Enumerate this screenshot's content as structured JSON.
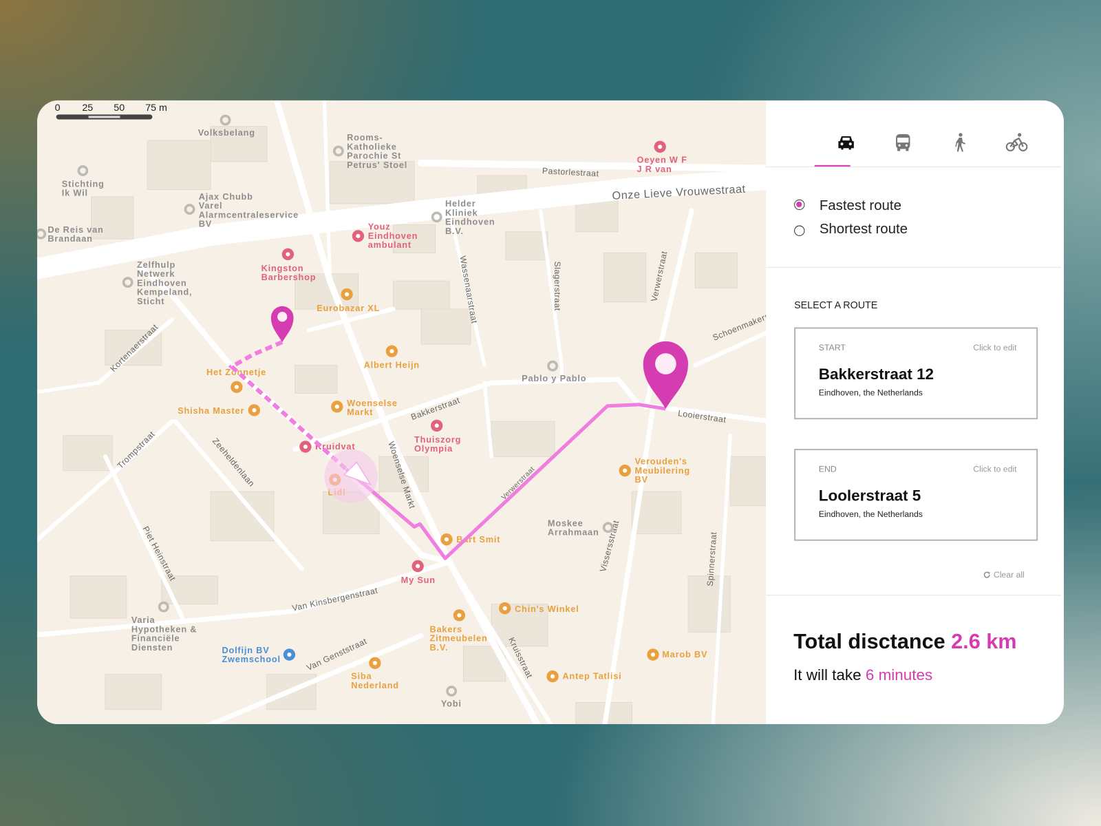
{
  "colors": {
    "accent": "#d63cb1",
    "route": "#f07ee0",
    "poi_gray": "#8e8e8e",
    "poi_pink": "#e0627c",
    "poi_orange": "#e9a03f",
    "poi_blue": "#4a8fd6"
  },
  "map": {
    "scale": {
      "ticks": [
        "0",
        "25",
        "50",
        "75 m"
      ]
    },
    "streets": [
      "Onze Lieve Vrouwestraat",
      "Pastorlestraat",
      "Wassenaarstraat",
      "Slagerstraat",
      "Verwerstraat",
      "Schoenmakerstraat",
      "Kortenaerstraat",
      "Trompstraat",
      "Zeeheldenlaan",
      "Piet Heinstraat",
      "Bakkerstraat",
      "Woenselse Markt",
      "Looierstraat",
      "Vissersstraat",
      "Spinnerstraat",
      "Van Kinsbergenstraat",
      "Van Genststraat",
      "Kruisstraat",
      "Verwerstraat"
    ],
    "pois": [
      {
        "lines": [
          "Volksbelang"
        ],
        "kind": "gray",
        "icon": "place-icon"
      },
      {
        "lines": [
          "Rooms-",
          "Katholieke",
          "Parochie St",
          "Petrus' Stoel"
        ],
        "kind": "gray",
        "icon": "place-icon"
      },
      {
        "lines": [
          "Stichting",
          "Ik Wil"
        ],
        "kind": "gray",
        "icon": "place-icon"
      },
      {
        "lines": [
          "Ajax Chubb",
          "Varel",
          "Alarmcentraleservice",
          "BV"
        ],
        "kind": "gray",
        "icon": "place-icon"
      },
      {
        "lines": [
          "De Reis van",
          "Brandaan"
        ],
        "kind": "gray",
        "icon": "place-icon"
      },
      {
        "lines": [
          "Helder",
          "Kliniek",
          "Eindhoven",
          "B.V."
        ],
        "kind": "gray",
        "icon": "place-icon"
      },
      {
        "lines": [
          "Zelfhulp",
          "Netwerk",
          "Eindhoven",
          "Kempeland,",
          "Sticht"
        ],
        "kind": "gray",
        "icon": "place-icon"
      },
      {
        "lines": [
          "Pablo y Pablo"
        ],
        "kind": "gray",
        "icon": "place-icon"
      },
      {
        "lines": [
          "Moskee",
          "Arrahmaan"
        ],
        "kind": "gray",
        "icon": "place-icon"
      },
      {
        "lines": [
          "Varia",
          "Hypotheken &",
          "Financiële",
          "Diensten"
        ],
        "kind": "gray",
        "icon": "place-icon"
      },
      {
        "lines": [
          "Yobi"
        ],
        "kind": "gray",
        "icon": "place-icon"
      },
      {
        "lines": [
          "Youz",
          "Eindhoven",
          "ambulant"
        ],
        "kind": "pink",
        "icon": "stethoscope-icon"
      },
      {
        "lines": [
          "Kingston",
          "Barbershop"
        ],
        "kind": "pink",
        "icon": "scissors-icon"
      },
      {
        "lines": [
          "Thuiszorg",
          "Olympia"
        ],
        "kind": "pink",
        "icon": "stethoscope-icon"
      },
      {
        "lines": [
          "Kruidvat"
        ],
        "kind": "pink",
        "icon": "pharmacy-icon"
      },
      {
        "lines": [
          "My Sun"
        ],
        "kind": "pink",
        "icon": "spa-icon"
      },
      {
        "lines": [
          "Oeyen W F",
          "J R van"
        ],
        "kind": "pink",
        "icon": "tooth-icon"
      },
      {
        "lines": [
          "Eurobazar XL"
        ],
        "kind": "orange",
        "icon": "shopping-bag-icon"
      },
      {
        "lines": [
          "Albert Heijn"
        ],
        "kind": "orange",
        "icon": "cart-icon"
      },
      {
        "lines": [
          "Het Zonnetje"
        ],
        "kind": "orange",
        "icon": "restaurant-icon"
      },
      {
        "lines": [
          "Shisha Master"
        ],
        "kind": "orange",
        "icon": "shopping-bag-icon"
      },
      {
        "lines": [
          "Woenselse",
          "Markt"
        ],
        "kind": "orange",
        "icon": "basket-icon"
      },
      {
        "lines": [
          "Lidl"
        ],
        "kind": "orange",
        "icon": "cart-icon"
      },
      {
        "lines": [
          "Bart Smit"
        ],
        "kind": "orange",
        "icon": "toy-icon"
      },
      {
        "lines": [
          "Verouden's",
          "Meubilering",
          "BV"
        ],
        "kind": "orange",
        "icon": "lamp-icon"
      },
      {
        "lines": [
          "Chin's Winkel"
        ],
        "kind": "orange",
        "icon": "cart-icon"
      },
      {
        "lines": [
          "Bakers",
          "Zitmeubelen",
          "B.V."
        ],
        "kind": "orange",
        "icon": "lamp-icon"
      },
      {
        "lines": [
          "Siba",
          "Nederland"
        ],
        "kind": "orange",
        "icon": "shopping-bag-icon"
      },
      {
        "lines": [
          "Antep Tatlisi"
        ],
        "kind": "orange",
        "icon": "restaurant-icon"
      },
      {
        "lines": [
          "Marob BV"
        ],
        "kind": "orange",
        "icon": "shopping-bag-icon"
      },
      {
        "lines": [
          "Dolfijn BV",
          "Zwemschool"
        ],
        "kind": "blue",
        "icon": "swimming-icon"
      }
    ]
  },
  "panel": {
    "modes": [
      {
        "name": "car",
        "active": true
      },
      {
        "name": "bus",
        "active": false
      },
      {
        "name": "walk",
        "active": false
      },
      {
        "name": "bike",
        "active": false
      }
    ],
    "options": [
      {
        "label": "Fastest route",
        "selected": true
      },
      {
        "label": "Shortest route",
        "selected": false
      }
    ],
    "section_title": "SELECT A ROUTE",
    "start": {
      "key": "START",
      "edit": "Click to edit",
      "title": "Bakkerstraat 12",
      "subtitle": "Eindhoven, the Netherlands"
    },
    "end": {
      "key": "END",
      "edit": "Click to edit",
      "title": "Loolerstraat 5",
      "subtitle": "Eindhoven, the Netherlands"
    },
    "clear_all": "Clear all",
    "total_label": "Total disctance",
    "total_value": "2.6 km",
    "time_label": "It will take",
    "time_value": "6 minutes"
  }
}
